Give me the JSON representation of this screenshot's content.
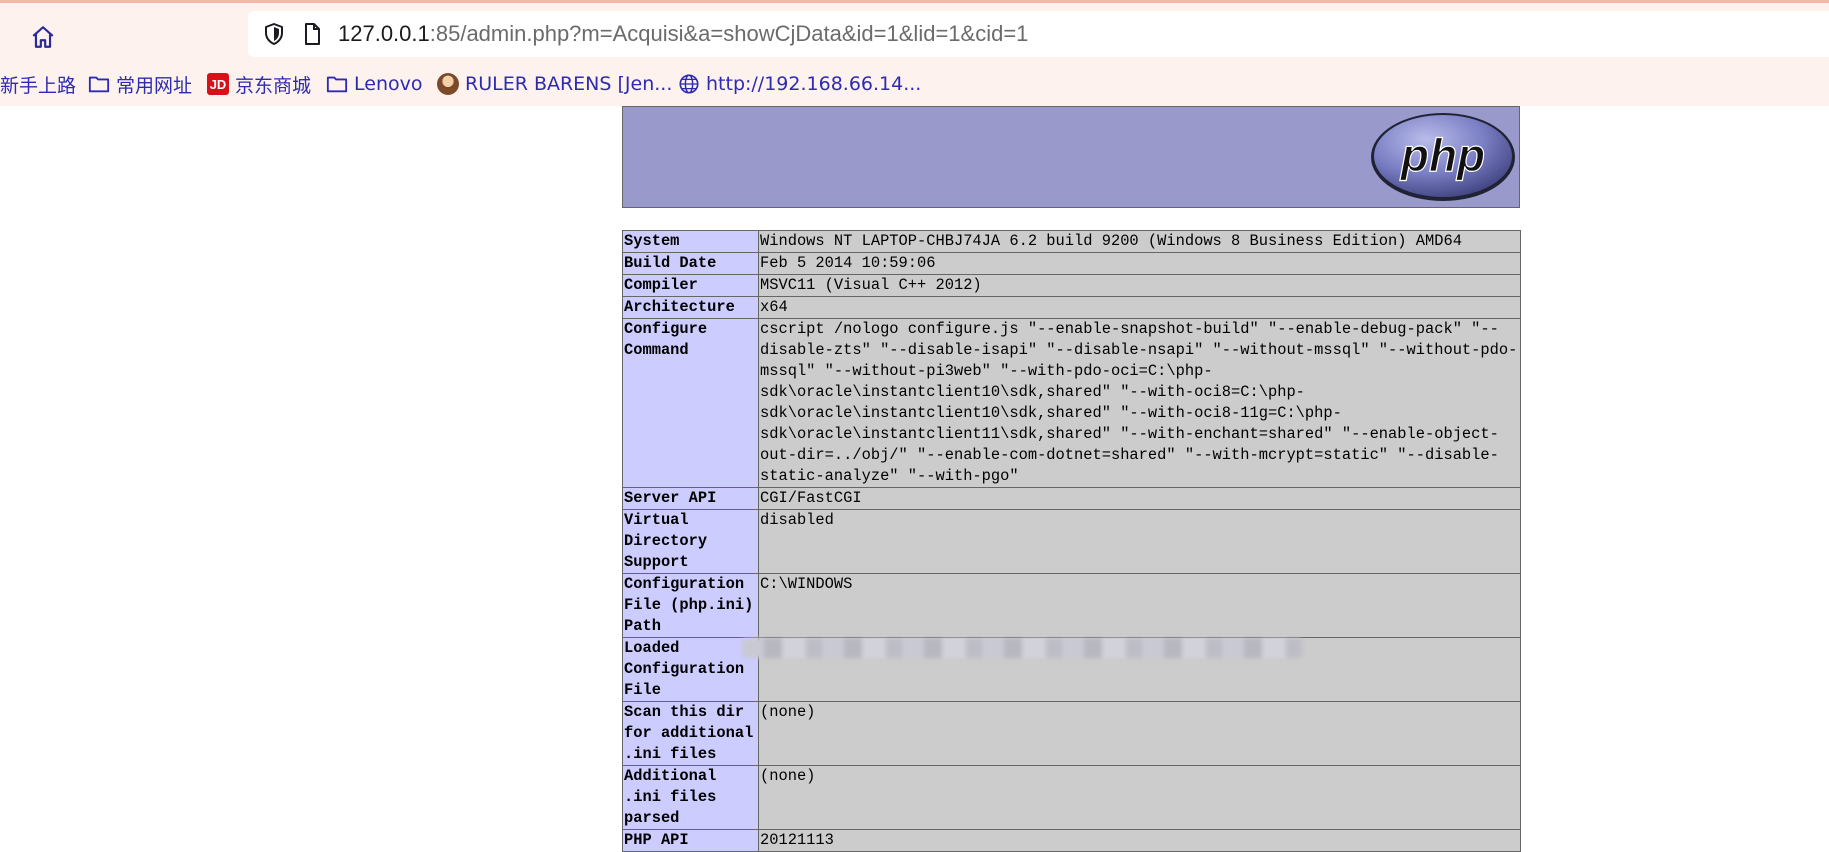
{
  "browser": {
    "url_host": "127.0.0.1",
    "url_rest": ":85/admin.php?m=Acquisi&a=showCjData&id=1&lid=1&cid=1",
    "bookmarks": [
      {
        "label": "新手上路",
        "icon": "none"
      },
      {
        "label": "常用网址",
        "icon": "folder-icon"
      },
      {
        "label": "京东商城",
        "icon": "jd-icon"
      },
      {
        "label": "Lenovo",
        "icon": "folder-icon"
      },
      {
        "label": "RULER BARENS [Jen...",
        "icon": "avatar-icon"
      },
      {
        "label": "http://192.168.66.14...",
        "icon": "globe-icon"
      }
    ],
    "colors": {
      "chrome_bg": "#fdf2ee",
      "bookmark_text": "#2d2bb0"
    }
  },
  "phpinfo": {
    "logo_text": "php",
    "colors": {
      "header_bg": "#9999cc",
      "key_bg": "#ccccff",
      "value_bg": "#cccccc"
    },
    "rows": [
      {
        "key": "System",
        "value": "Windows NT LAPTOP-CHBJ74JA 6.2 build 9200 (Windows 8 Business Edition) AMD64"
      },
      {
        "key": "Build Date",
        "value": "Feb 5 2014 10:59:06"
      },
      {
        "key": "Compiler",
        "value": "MSVC11 (Visual C++ 2012)"
      },
      {
        "key": "Architecture",
        "value": "x64"
      },
      {
        "key": "Configure Command",
        "value": "cscript /nologo configure.js \"--enable-snapshot-build\" \"--enable-debug-pack\" \"--disable-zts\" \"--disable-isapi\" \"--disable-nsapi\" \"--without-mssql\" \"--without-pdo-mssql\" \"--without-pi3web\" \"--with-pdo-oci=C:\\php-sdk\\oracle\\instantclient10\\sdk,shared\" \"--with-oci8=C:\\php-sdk\\oracle\\instantclient10\\sdk,shared\" \"--with-oci8-11g=C:\\php-sdk\\oracle\\instantclient11\\sdk,shared\" \"--with-enchant=shared\" \"--enable-object-out-dir=../obj/\" \"--enable-com-dotnet=shared\" \"--with-mcrypt=static\" \"--disable-static-analyze\" \"--with-pgo\""
      },
      {
        "key": "Server API",
        "value": "CGI/FastCGI"
      },
      {
        "key": "Virtual Directory Support",
        "value": "disabled"
      },
      {
        "key": "Configuration File (php.ini) Path",
        "value": "C:\\WINDOWS"
      },
      {
        "key": "Loaded Configuration File",
        "value": ""
      },
      {
        "key": "Scan this dir for additional .ini files",
        "value": "(none)"
      },
      {
        "key": "Additional .ini files parsed",
        "value": "(none)"
      },
      {
        "key": "PHP API",
        "value": "20121113"
      }
    ]
  }
}
